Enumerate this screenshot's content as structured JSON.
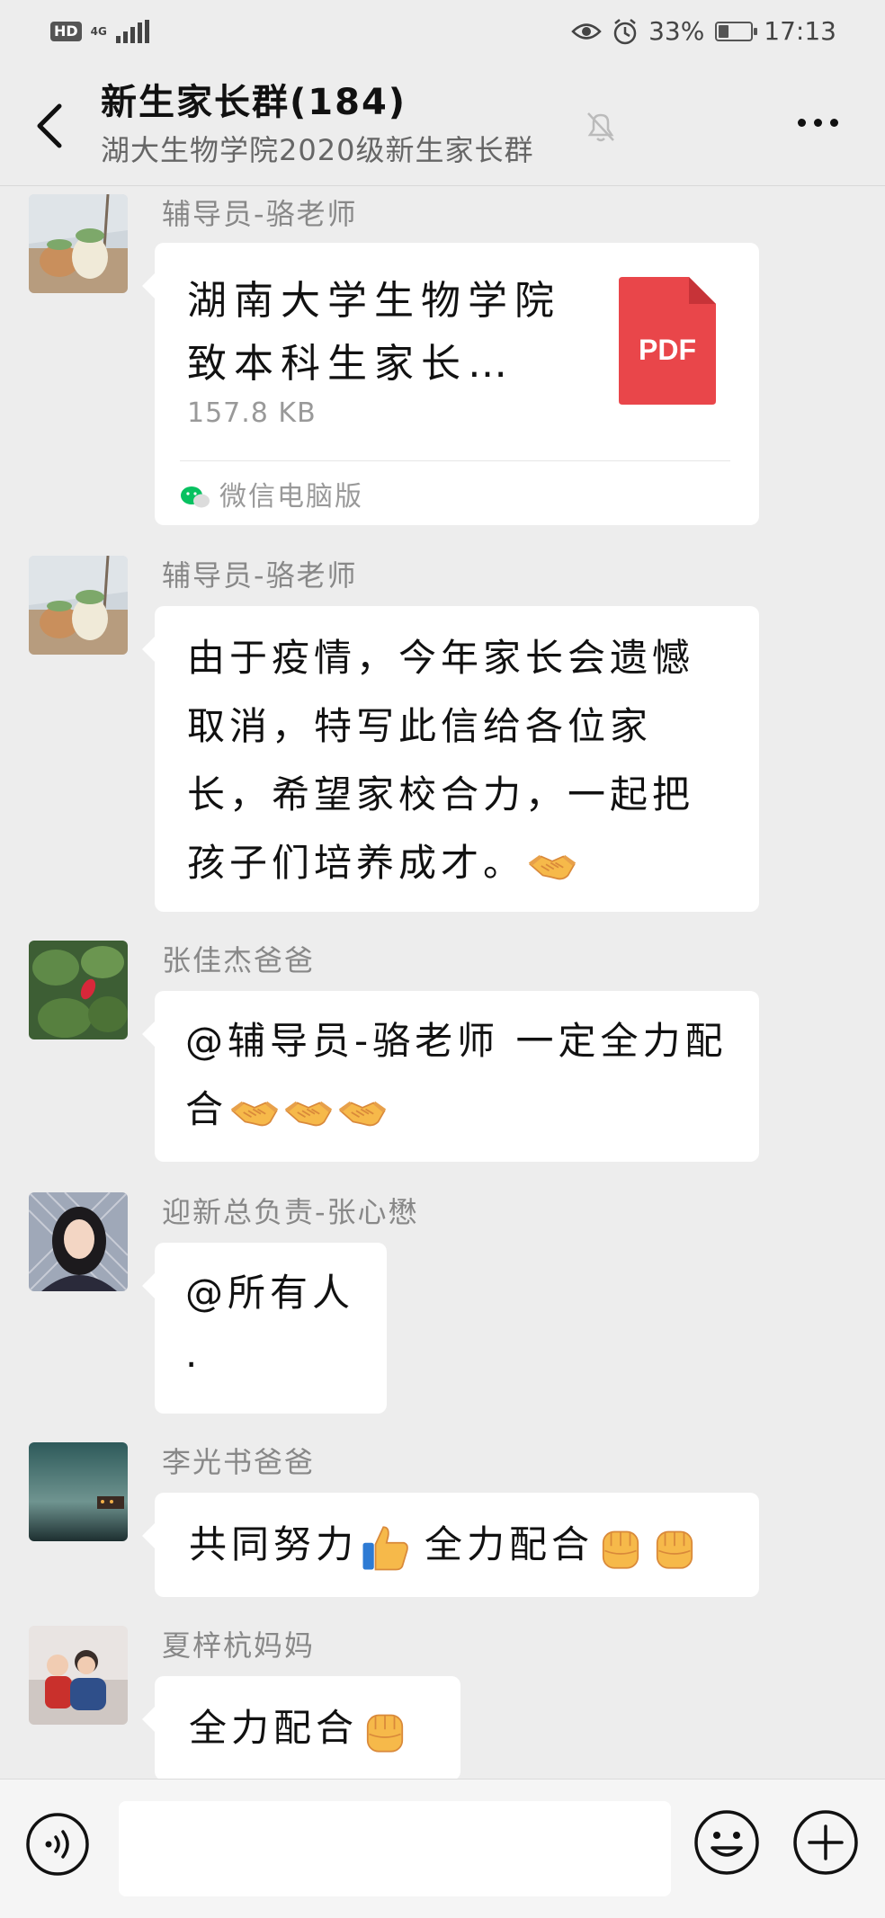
{
  "status_bar": {
    "hd": "HD",
    "network": "4G",
    "battery_percent": "33%",
    "battery_level": 0.33,
    "time": "17:13",
    "icons": [
      "eye-icon",
      "alarm-icon",
      "battery-icon",
      "signal-icon"
    ]
  },
  "header": {
    "title": "新生家长群(184)",
    "subtitle": "湖大生物学院2020级新生家长群",
    "icons": [
      "back-arrow-icon",
      "mute-bell-icon",
      "more-icon"
    ]
  },
  "messages": [
    {
      "sender": "辅导员-骆老师",
      "type": "file",
      "file_name": "湖南大学生物学院致本科生家长…",
      "file_size": "157.8 KB",
      "file_type": "PDF",
      "source": "微信电脑版"
    },
    {
      "sender": "辅导员-骆老师",
      "type": "text",
      "text": "由于疫情，今年家长会遗憾取消，特写此信给各位家长，希望家校合力，一起把孩子们培养成才。",
      "emojis": [
        "handshake"
      ]
    },
    {
      "sender": "张佳杰爸爸",
      "type": "text",
      "text": "@辅导员-骆老师  一定全力配合",
      "emojis": [
        "handshake",
        "handshake",
        "handshake"
      ]
    },
    {
      "sender": "迎新总负责-张心懋",
      "type": "text",
      "text": "@所有人",
      "line2": "."
    },
    {
      "sender": "李光书爸爸",
      "type": "text",
      "text_a": "共同努力",
      "text_b": "全力配合",
      "emojis": [
        "thumbs-up",
        "fist",
        "fist"
      ]
    },
    {
      "sender": "夏梓杭妈妈",
      "type": "text",
      "text": "全力配合",
      "emojis": [
        "fist"
      ]
    }
  ],
  "input_bar": {
    "placeholder": "",
    "icons": [
      "voice-icon",
      "emoji-icon",
      "plus-icon"
    ]
  },
  "colors": {
    "background": "#ededed",
    "bubble": "#ffffff",
    "pdf_red": "#e9464a",
    "wechat_green": "#07c160",
    "emoji_yellow": "#f6b94a"
  }
}
